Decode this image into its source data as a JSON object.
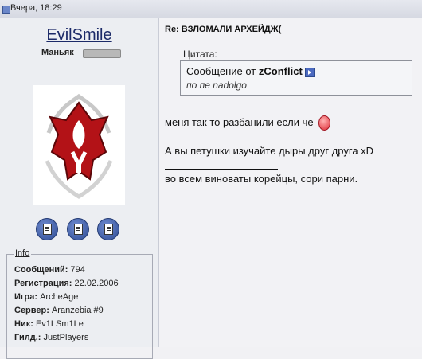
{
  "header": {
    "date": "Вчера, 18:29"
  },
  "user": {
    "name": "EvilSmile",
    "rank": "Маньяк",
    "avatar": "horde-emblem"
  },
  "action_buttons": [
    {
      "icon": "pm-icon"
    },
    {
      "icon": "quote-icon"
    },
    {
      "icon": "profile-icon"
    }
  ],
  "info": {
    "legend": "Info",
    "rows": [
      {
        "label": "Сообщений:",
        "value": "794"
      },
      {
        "label": "Регистрация:",
        "value": "22.02.2006"
      },
      {
        "label": "Игра:",
        "value": "ArcheAge"
      },
      {
        "label": "Сервер:",
        "value": "Aranzebia #9"
      },
      {
        "label": "Ник:",
        "value": "Ev1LSm1Le"
      },
      {
        "label": "Гилд.:",
        "value": "JustPlayers"
      }
    ]
  },
  "post": {
    "title": "Re: ВЗЛОМАЛИ АРХЕЙДЖ(",
    "quote": {
      "label": "Цитата:",
      "prefix": "Сообщение от",
      "author": "zConflict",
      "text": "по пе nadolgo"
    },
    "lines": [
      "меня так то разбанили если че",
      "А вы петушки изучайте дыры друг друга xD",
      "во всем виноваты корейцы, сори парни."
    ]
  }
}
